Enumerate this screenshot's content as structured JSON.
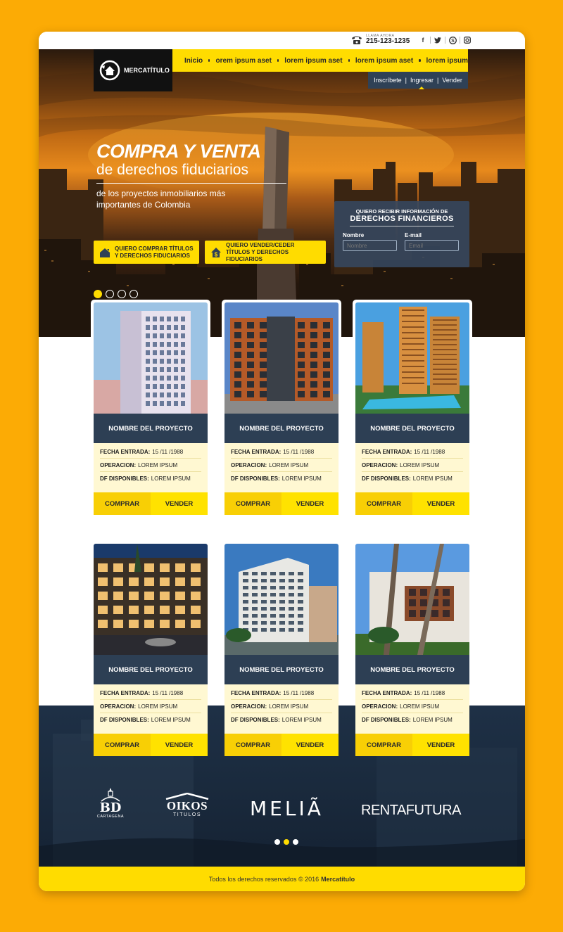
{
  "top": {
    "phone_label": "LLAMA AHORA",
    "phone_number": "215-123-1235",
    "socials": [
      "facebook-icon",
      "twitter-icon",
      "skype-icon",
      "instagram-icon"
    ]
  },
  "brand": {
    "name": "MERCATÍTULO"
  },
  "nav": {
    "items": [
      {
        "label": "Inicio"
      },
      {
        "label": "orem ipsum aset"
      },
      {
        "label": "lorem ipsum aset"
      },
      {
        "label": "lorem ipsum aset"
      },
      {
        "label": "lorem ipsum"
      }
    ]
  },
  "account": {
    "signup": "Inscríbete",
    "login": "Ingresar",
    "sell": "Vender"
  },
  "hero": {
    "title": "COMPRA Y VENTA",
    "title2": "de derechos fiduciarios",
    "subtitle": "de los proyectos inmobiliarios más importantes de Colombia",
    "cta_buy_line1": "QUIERO COMPRAR TÍTULOS",
    "cta_buy_line2": "Y DERECHOS FIDUCIARIOS",
    "cta_sell_line1": "QUIERO VENDER/CEDER",
    "cta_sell_line2": "TÍTULOS Y DERECHOS FIDUCIARIOS",
    "slides": 4,
    "active_slide": 1
  },
  "form": {
    "title_line1": "QUIERO RECIBIR INFORMACIÓN DE",
    "title_line2": "DERECHOS FINANCIEROS",
    "name_label": "Nombre",
    "name_placeholder": "Nombre",
    "email_label": "E-mail",
    "email_placeholder": "Email"
  },
  "projects": [
    {
      "name": "NOMBRE DEL PROYECTO",
      "fecha_label": "FECHA ENTRADA:",
      "fecha": "15 /11 /1988",
      "operacion_label": "OPERACION:",
      "operacion": "LOREM IPSUM",
      "df_label": "DF DISPONIBLES:",
      "df": "LOREM IPSUM",
      "buy": "COMPRAR",
      "sell": "VENDER"
    },
    {
      "name": "NOMBRE DEL PROYECTO",
      "fecha_label": "FECHA ENTRADA:",
      "fecha": "15 /11 /1988",
      "operacion_label": "OPERACION:",
      "operacion": "LOREM IPSUM",
      "df_label": "DF DISPONIBLES:",
      "df": "LOREM IPSUM",
      "buy": "COMPRAR",
      "sell": "VENDER"
    },
    {
      "name": "NOMBRE DEL PROYECTO",
      "fecha_label": "FECHA ENTRADA:",
      "fecha": "15 /11 /1988",
      "operacion_label": "OPERACION:",
      "operacion": "LOREM IPSUM",
      "df_label": "DF DISPONIBLES:",
      "df": "LOREM IPSUM",
      "buy": "COMPRAR",
      "sell": "VENDER"
    },
    {
      "name": "NOMBRE DEL PROYECTO",
      "fecha_label": "FECHA ENTRADA:",
      "fecha": "15 /11 /1988",
      "operacion_label": "OPERACION:",
      "operacion": "LOREM IPSUM",
      "df_label": "DF DISPONIBLES:",
      "df": "LOREM IPSUM",
      "buy": "COMPRAR",
      "sell": "VENDER"
    },
    {
      "name": "NOMBRE DEL PROYECTO",
      "fecha_label": "FECHA ENTRADA:",
      "fecha": "15 /11 /1988",
      "operacion_label": "OPERACION:",
      "operacion": "LOREM IPSUM",
      "df_label": "DF DISPONIBLES:",
      "df": "LOREM IPSUM",
      "buy": "COMPRAR",
      "sell": "VENDER"
    },
    {
      "name": "NOMBRE DEL PROYECTO",
      "fecha_label": "FECHA ENTRADA:",
      "fecha": "15 /11 /1988",
      "operacion_label": "OPERACION:",
      "operacion": "LOREM IPSUM",
      "df_label": "DF DISPONIBLES:",
      "df": "LOREM IPSUM",
      "buy": "COMPRAR",
      "sell": "VENDER"
    }
  ],
  "partners": {
    "bd": "BD",
    "bd_sub": "CARTAGENA",
    "oikos": "OIKOS",
    "oikos_sub": "TITULOS",
    "melia": "MELIÃ",
    "renta": "RENTAFUTURA",
    "slides": 3,
    "active_slide": 2
  },
  "footer": {
    "text": "Todos los derechos reservados © 2016",
    "brand": "Mercatítulo"
  },
  "colors": {
    "accent": "#ffdc00",
    "page_bg": "#fcab05",
    "navy": "#2d3f54",
    "info_bg": "#fff8d2"
  }
}
